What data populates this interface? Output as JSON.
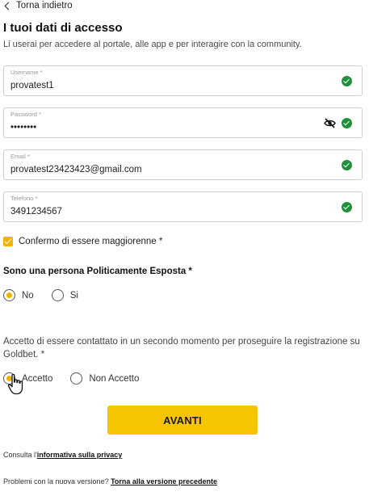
{
  "nav": {
    "back_label": "Torna indietro"
  },
  "header": {
    "title": "I tuoi dati di accesso",
    "subtitle": "Li userai per accedere al portale, alle app e per interagire con la community."
  },
  "fields": {
    "username": {
      "label": "Username *",
      "value": "provatest1"
    },
    "password": {
      "label": "Password *",
      "value": "••••••••"
    },
    "email": {
      "label": "Email *",
      "value": "provatest23423423@gmail.com"
    },
    "phone": {
      "label": "Telefono *",
      "value": "3491234567"
    }
  },
  "age_confirm": {
    "label": "Confermo di essere maggiorenne *",
    "checked": true
  },
  "pep": {
    "heading": "Sono una persona Politicamente Esposta *",
    "options": [
      {
        "label": "No",
        "selected": true
      },
      {
        "label": "Si",
        "selected": false
      }
    ]
  },
  "contact": {
    "text": "Accetto di essere contattato in un secondo momento per proseguire la registrazione su Goldbet. *",
    "options": [
      {
        "label": "Accetto",
        "selected": true
      },
      {
        "label": "Non Accetto",
        "selected": false
      }
    ]
  },
  "actions": {
    "submit_label": "AVANTI"
  },
  "footer": {
    "privacy_prefix": "Consulta l'",
    "privacy_link": "informativa sulla privacy",
    "version_prefix": "Problemi con la nuova versione? ",
    "version_link": "Torna alla versione precedente"
  },
  "colors": {
    "accent": "#f7c400",
    "check_green": "#1f8f3a"
  },
  "icons": {
    "back": "chevron-left-icon",
    "valid": "check-circle-icon",
    "toggle_password": "eye-off-icon",
    "pointer": "hand-cursor-icon"
  }
}
